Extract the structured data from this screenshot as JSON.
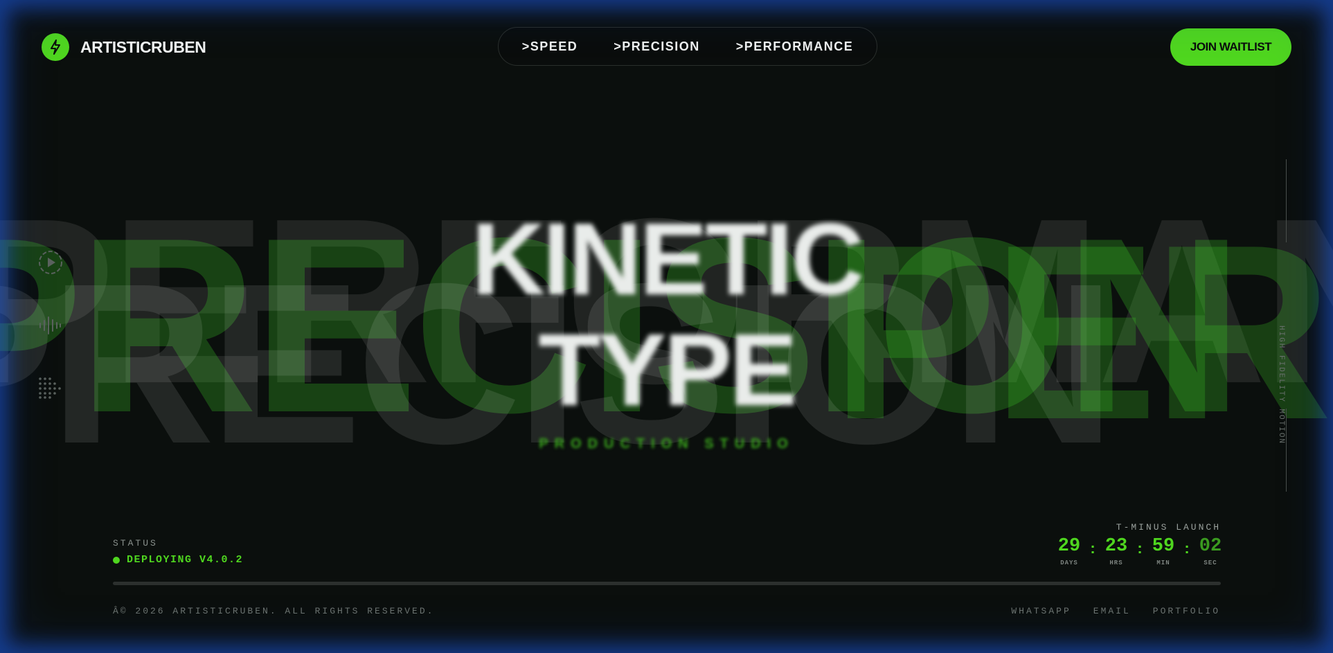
{
  "brand": {
    "name": "ARTISTICRUBEN",
    "logo_icon": "lightning-icon",
    "accent": "#4fd61f"
  },
  "nav": {
    "items": [
      ">SPEED",
      ">PRECISION",
      ">PERFORMANCE"
    ]
  },
  "cta": {
    "label": "JOIN WAITLIST"
  },
  "hero": {
    "line1": "KINETIC",
    "line2": "TYPE",
    "subtitle": "PRODUCTION STUDIO"
  },
  "background_words": [
    "PERFORMANCE",
    "PRECISION",
    "PRECISION",
    "PERFORMANCE"
  ],
  "side_icons": [
    "play-circle-icon",
    "waveform-icon",
    "dot-grid-icon"
  ],
  "rail": {
    "text": "HIGH FIDELITY MOTION"
  },
  "status": {
    "label": "STATUS",
    "text": "DEPLOYING V4.0.2",
    "color": "#4fd61f"
  },
  "countdown": {
    "label": "T-MINUS LAUNCH",
    "units": [
      {
        "value": "29",
        "label": "DAYS"
      },
      {
        "value": "23",
        "label": "HRS"
      },
      {
        "value": "59",
        "label": "MIN"
      },
      {
        "value": "02",
        "label": "SEC"
      }
    ],
    "separator": ":"
  },
  "progress": {
    "fraction": 0.0
  },
  "footer": {
    "copyright": "Â© 2026 ARTISTICRUBEN. ALL RIGHTS RESERVED.",
    "links": [
      "WHATSAPP",
      "EMAIL",
      "PORTFOLIO"
    ]
  }
}
